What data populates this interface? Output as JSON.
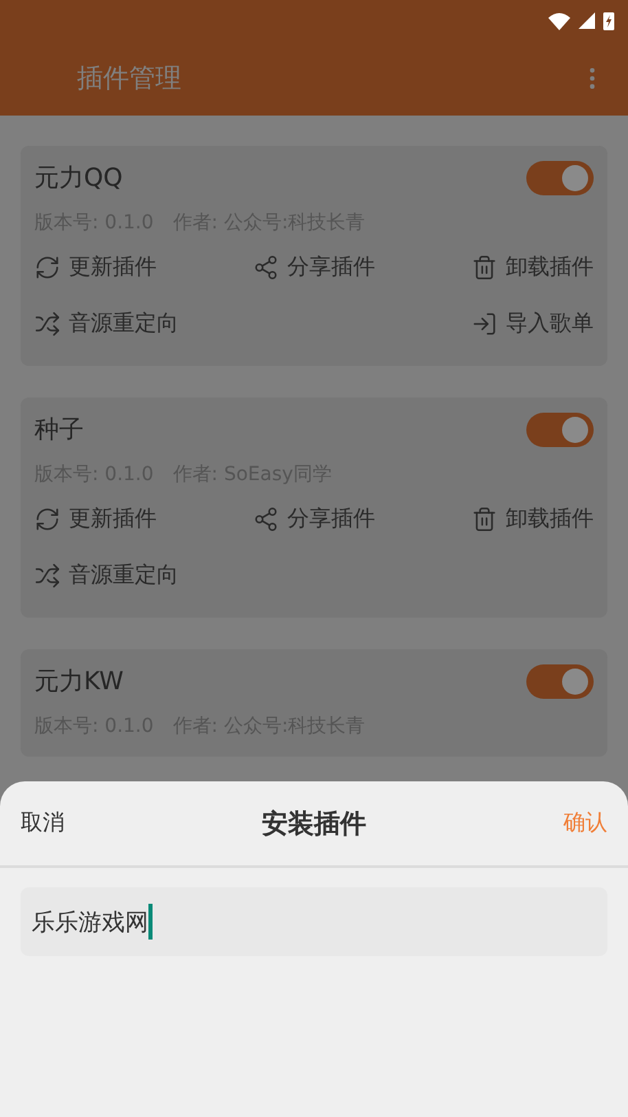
{
  "app_bar": {
    "title": "插件管理"
  },
  "plugins": [
    {
      "name": "元力QQ",
      "enabled": true,
      "version": "版本号: 0.1.0",
      "author": "作者: 公众号:科技长青",
      "action_rows": [
        [
          {
            "kind": "refresh",
            "label": "更新插件"
          },
          {
            "kind": "share",
            "label": "分享插件"
          },
          {
            "kind": "trash",
            "label": "卸载插件"
          }
        ],
        [
          {
            "kind": "redirect",
            "label": "音源重定向"
          },
          {
            "kind": "import",
            "label": "导入歌单"
          }
        ]
      ]
    },
    {
      "name": "种子",
      "enabled": true,
      "version": "版本号: 0.1.0",
      "author": "作者: SoEasy同学",
      "action_rows": [
        [
          {
            "kind": "refresh",
            "label": "更新插件"
          },
          {
            "kind": "share",
            "label": "分享插件"
          },
          {
            "kind": "trash",
            "label": "卸载插件"
          }
        ],
        [
          {
            "kind": "redirect",
            "label": "音源重定向"
          }
        ]
      ]
    },
    {
      "name": "元力KW",
      "enabled": true,
      "version": "版本号: 0.1.0",
      "author": "作者: 公众号:科技长青"
    }
  ],
  "sheet": {
    "cancel": "取消",
    "title": "安装插件",
    "confirm": "确认",
    "input": {
      "value": "乐乐游戏网"
    }
  }
}
